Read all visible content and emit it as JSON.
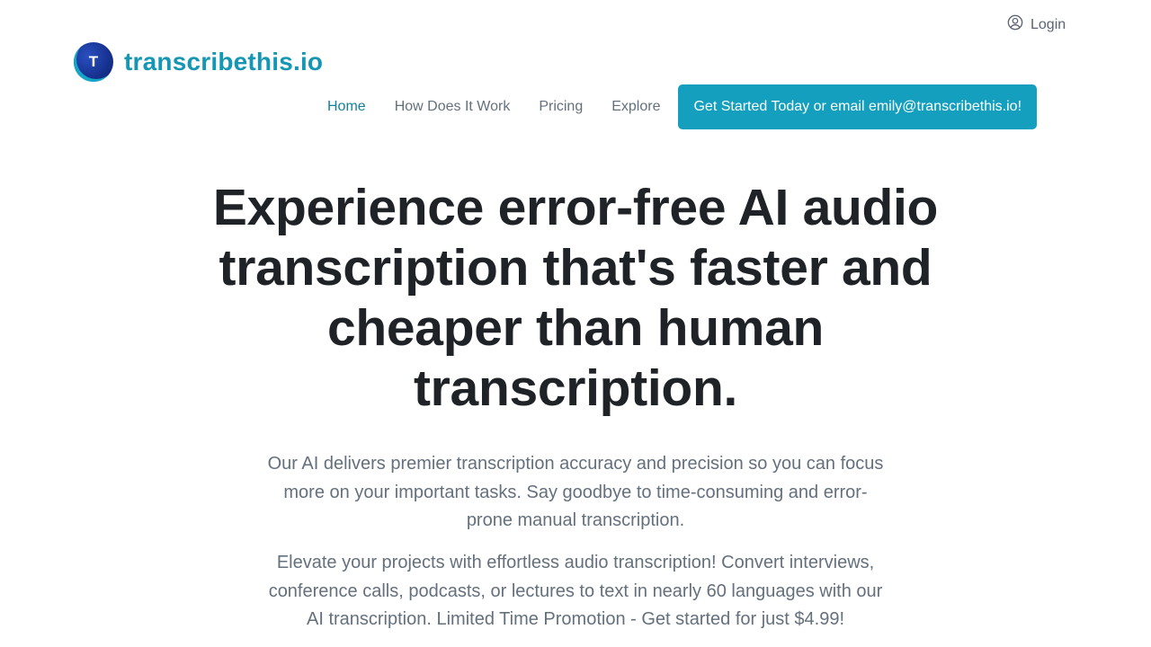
{
  "header": {
    "login_label": "Login",
    "login_icon": "user-circle-icon",
    "logo": {
      "mark_letter": "T",
      "text": "transcribethis.io"
    },
    "nav": {
      "items": [
        {
          "label": "Home",
          "active": true
        },
        {
          "label": "How Does It Work",
          "active": false
        },
        {
          "label": "Pricing",
          "active": false
        },
        {
          "label": "Explore",
          "active": false
        }
      ],
      "cta_label": "Get Started Today or email emily@transcribethis.io!"
    }
  },
  "hero": {
    "title": "Experience error-free AI audio transcription that's faster and cheaper than human transcription.",
    "paragraphs": [
      "Our AI delivers premier transcription accuracy and precision so you can focus more on your important tasks. Say goodbye to time-consuming and error-prone manual transcription.",
      "Elevate your projects with effortless audio transcription! Convert interviews, conference calls, podcasts, or lectures to text in nearly 60 languages with our AI transcription. Limited Time Promotion - Get started for just $4.99!"
    ]
  },
  "colors": {
    "brand": "#1596b4",
    "cta_bg": "#139fbd",
    "nav_active": "#16809c",
    "text_muted": "#64707d",
    "heading": "#1f2226"
  }
}
